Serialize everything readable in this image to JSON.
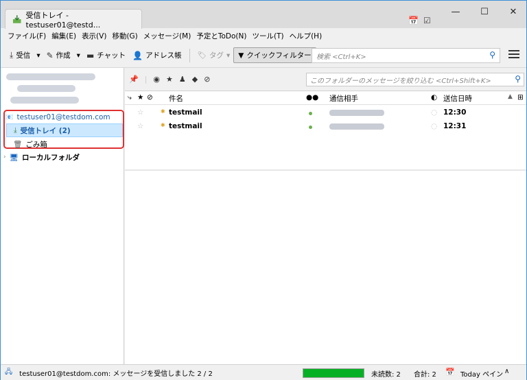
{
  "window": {
    "tab_title": "受信トレイ - testuser01@testd...",
    "controls": {
      "minimize": "—",
      "maximize": "☐",
      "close": "✕"
    }
  },
  "menu": [
    "ファイル(F)",
    "編集(E)",
    "表示(V)",
    "移動(G)",
    "メッセージ(M)",
    "予定とToDo(N)",
    "ツール(T)",
    "ヘルプ(H)"
  ],
  "toolbar": {
    "receive": "受信",
    "compose": "作成",
    "chat": "チャット",
    "addressbook": "アドレス帳",
    "tag": "タグ",
    "quickfilter": "クイックフィルター",
    "search_placeholder": "検索 <Ctrl+K>"
  },
  "folders": {
    "account": "testuser01@testdom.com",
    "inbox": "受信トレイ (2)",
    "trash": "ごみ箱",
    "local": "ローカルフォルダ"
  },
  "quickfilter_bar": {
    "filter_placeholder": "このフォルダーのメッセージを絞り込む <Ctrl+Shift+K>"
  },
  "columns": {
    "subject": "件名",
    "correspondent": "通信相手",
    "date": "送信日時"
  },
  "messages": [
    {
      "subject": "testmail",
      "time": "12:30"
    },
    {
      "subject": "testmail",
      "time": "12:31"
    }
  ],
  "status": {
    "message": "testuser01@testdom.com: メッセージを受信しました 2 / 2",
    "progress": 1.0,
    "unread": "未読数: 2",
    "total": "合計: 2",
    "today": "Today ペイン"
  },
  "colors": {
    "accent": "#3b8ed6",
    "selected": "#cce8ff",
    "highlight_border": "#e03030",
    "progress": "#06b025"
  }
}
